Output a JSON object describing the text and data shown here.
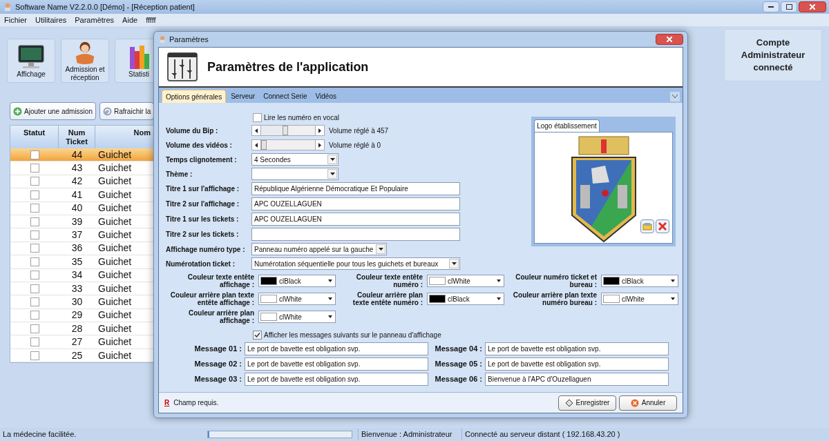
{
  "window": {
    "title": "Software Name V2.2.0.0 [Démo] - [Réception patient]"
  },
  "menu": [
    "Fichier",
    "Utilitaires",
    "Paramètres",
    "Aide",
    "fffff"
  ],
  "toolbar": [
    {
      "label": "Affichage",
      "kind": "display"
    },
    {
      "label": "Admission et réception",
      "kind": "reception"
    },
    {
      "label": "Statisti",
      "kind": "stats"
    }
  ],
  "account_panel": {
    "text": "Compte Administrateur connecté"
  },
  "actions": [
    {
      "label": "Ajouter une admission",
      "kind": "add"
    },
    {
      "label": "Rafraichir la",
      "kind": "refresh"
    }
  ],
  "table": {
    "columns": [
      "Statut",
      "Num Ticket",
      "Nom"
    ],
    "rows": [
      {
        "checked": false,
        "selected": true,
        "ticket": "44",
        "name": "Guichet"
      },
      {
        "checked": false,
        "selected": false,
        "ticket": "43",
        "name": "Guichet"
      },
      {
        "checked": false,
        "selected": false,
        "ticket": "42",
        "name": "Guichet"
      },
      {
        "checked": false,
        "selected": false,
        "ticket": "41",
        "name": "Guichet"
      },
      {
        "checked": false,
        "selected": false,
        "ticket": "40",
        "name": "Guichet"
      },
      {
        "checked": false,
        "selected": false,
        "ticket": "39",
        "name": "Guichet"
      },
      {
        "checked": false,
        "selected": false,
        "ticket": "37",
        "name": "Guichet"
      },
      {
        "checked": false,
        "selected": false,
        "ticket": "36",
        "name": "Guichet"
      },
      {
        "checked": false,
        "selected": false,
        "ticket": "35",
        "name": "Guichet"
      },
      {
        "checked": false,
        "selected": false,
        "ticket": "34",
        "name": "Guichet"
      },
      {
        "checked": false,
        "selected": false,
        "ticket": "33",
        "name": "Guichet"
      },
      {
        "checked": false,
        "selected": false,
        "ticket": "30",
        "name": "Guichet"
      },
      {
        "checked": false,
        "selected": false,
        "ticket": "29",
        "name": "Guichet"
      },
      {
        "checked": false,
        "selected": false,
        "ticket": "28",
        "name": "Guichet"
      },
      {
        "checked": false,
        "selected": false,
        "ticket": "27",
        "name": "Guichet"
      },
      {
        "checked": false,
        "selected": false,
        "ticket": "25",
        "name": "Guichet"
      }
    ]
  },
  "dialog": {
    "title": "Paramètres",
    "heading": "Paramètres de l'application",
    "tabs": [
      {
        "label": "Options générales",
        "selected": true
      },
      {
        "label": "Serveur",
        "selected": false
      },
      {
        "label": "Connect Serie",
        "selected": false
      },
      {
        "label": "Vidéos",
        "selected": false
      }
    ],
    "vocal": {
      "label": "Lire les numéro en vocal",
      "checked": false
    },
    "sliders": [
      {
        "label": "Volume du Bip :",
        "level": 0.45,
        "reading": "Volume réglé à 457"
      },
      {
        "label": "Volume des vidéos :",
        "level": 0,
        "reading": "Volume réglé à 0"
      }
    ],
    "fields": [
      {
        "label": "Temps clignotement :",
        "kind": "select",
        "value": "4 Secondes"
      },
      {
        "label": "Thème :",
        "kind": "select"
      },
      {
        "label": "Titre 1 sur l'affichage :",
        "kind": "text",
        "value": "République Algérienne Démocratique Et Populaire"
      },
      {
        "label": "Titre 2 sur l'affichage :",
        "kind": "text",
        "value": "APC OUZELLAGUEN"
      },
      {
        "label": "Titre 1 sur les tickets :",
        "kind": "text",
        "value": "APC OUZELLAGUEN"
      },
      {
        "label": "Titre 2 sur les tickets :",
        "kind": "text"
      },
      {
        "label": "Affichage numéro type :",
        "kind": "select",
        "value": "Panneau numéro appelé sur la gauche"
      },
      {
        "label": "Numérotation ticket :",
        "kind": "select",
        "value": "Numérotation séquentielle pour tous les guichets et bureaux"
      }
    ],
    "color_settings": [
      {
        "label": "Couleur texte entête affichage :",
        "value": "clBlack",
        "color": "#000000"
      },
      {
        "label": "Couleur texte entête numéro :",
        "value": "clWhite",
        "color": "#ffffff"
      },
      {
        "label": "Couleur numéro ticket et bureau :",
        "value": "clBlack",
        "color": "#000000"
      },
      {
        "label": "Couleur arrière plan texte entête affichage :",
        "value": "clWhite",
        "color": "#ffffff"
      },
      {
        "label": "Couleur arrière plan texte entête numéro :",
        "value": "clBlack",
        "color": "#000000"
      },
      {
        "label": "Couleur arrière plan texte numéro bureau :",
        "value": "clWhite",
        "color": "#ffffff"
      },
      {
        "label": "Couleur arrière plan affichage :",
        "value": "clWhite",
        "color": "#ffffff"
      }
    ],
    "messages_toggle": {
      "label": "Afficher les messages suivants sur le panneau d'affichage",
      "checked": true
    },
    "messages": [
      {
        "label": "Message 01 :",
        "value": "Le port de bavette est obligation svp."
      },
      {
        "label": "Message 02 :",
        "value": "Le port de bavette est obligation svp."
      },
      {
        "label": "Message 03 :",
        "value": "Le port de bavette est obligation svp."
      },
      {
        "label": "Message 04 :",
        "value": "Le port de bavette est obligation svp."
      },
      {
        "label": "Message 05 :",
        "value": "Le port de bavette est obligation svp."
      },
      {
        "label": "Message 06 :",
        "value": "Bienvenue à l'APC d'Ouzellaguen"
      }
    ],
    "logo": {
      "tab": "Logo établissement"
    },
    "required_note": {
      "mark": "R",
      "text": "Champ requis."
    },
    "buttons": [
      {
        "label": "Enregistrer",
        "kind": "save"
      },
      {
        "label": "Annuler",
        "kind": "cancel"
      }
    ]
  },
  "status_bar": {
    "text": "La médecine facilitée.",
    "level": 0.01,
    "user": "Bienvenue : Administrateur",
    "server": "Connecté au serveur distant ( 192.168.43.20 )"
  }
}
